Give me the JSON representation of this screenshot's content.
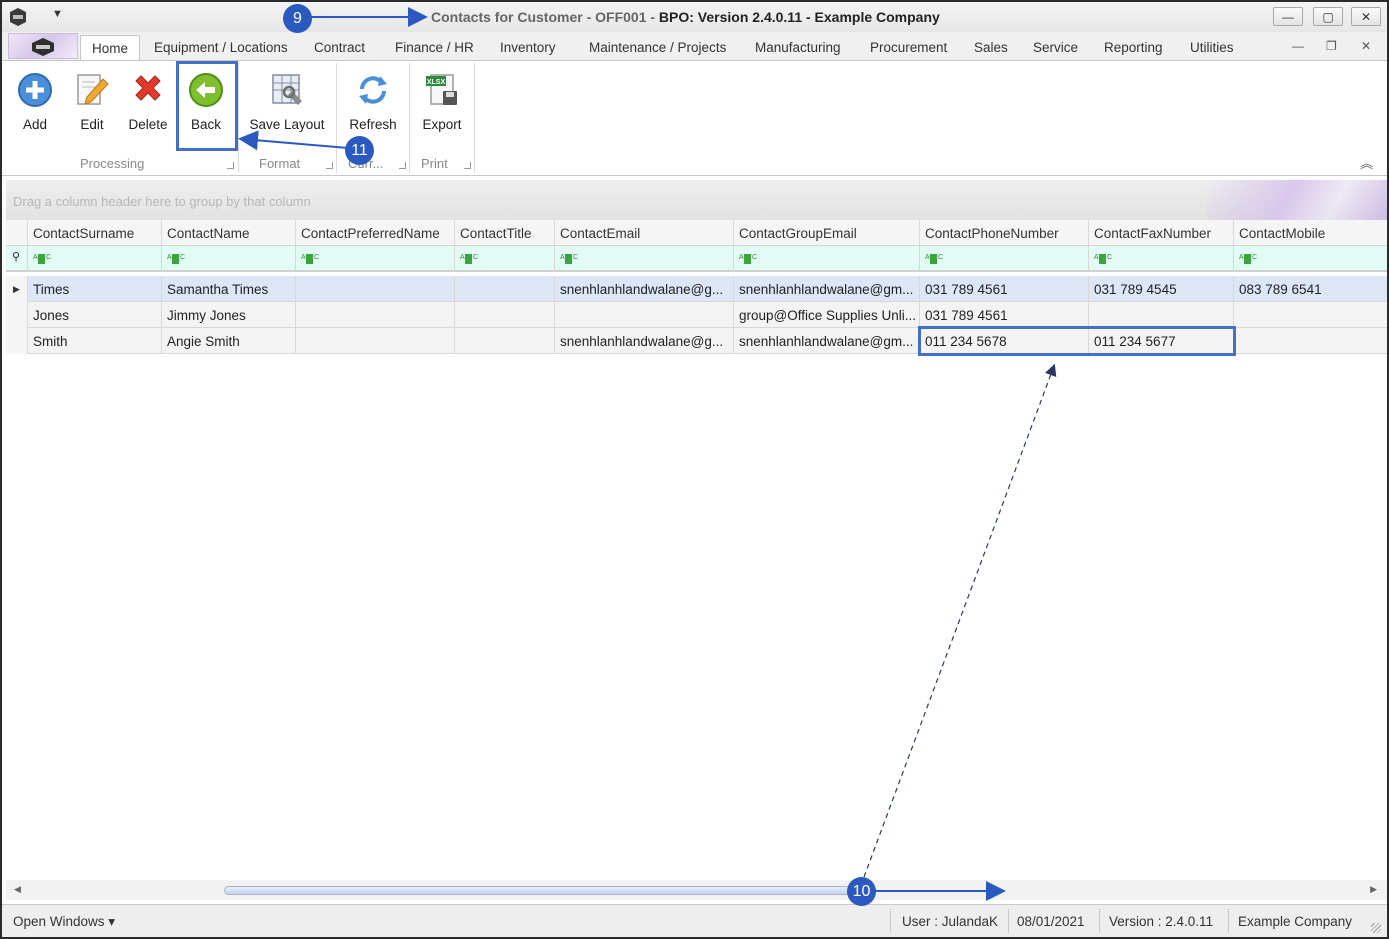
{
  "titlebar": {
    "title_part1": "Contacts for Customer - OFF001 - ",
    "title_part2": "BPO: Version 2.4.0.11 - Example Company",
    "minimize": "—",
    "maximize": "▢",
    "close": "✕"
  },
  "tabs": [
    "Home",
    "Equipment / Locations",
    "Contract",
    "Finance / HR",
    "Inventory",
    "Maintenance / Projects",
    "Manufacturing",
    "Procurement",
    "Sales",
    "Service",
    "Reporting",
    "Utilities"
  ],
  "mdi_controls": {
    "minimize": "—",
    "restore": "❐",
    "close": "✕"
  },
  "ribbon": {
    "buttons": {
      "add": "Add",
      "edit": "Edit",
      "delete": "Delete",
      "back": "Back",
      "save_layout": "Save Layout",
      "refresh": "Refresh",
      "export": "Export"
    },
    "groups": {
      "processing": "Processing",
      "format": "Format",
      "current": "Curr...",
      "print": "Print"
    },
    "export_badge": "XLSX"
  },
  "grid": {
    "group_panel_hint": "Drag a column header here to group by that column",
    "columns": [
      "ContactSurname",
      "ContactName",
      "ContactPreferredName",
      "ContactTitle",
      "ContactEmail",
      "ContactGroupEmail",
      "ContactPhoneNumber",
      "ContactFaxNumber",
      "ContactMobile"
    ],
    "rows": [
      [
        "Times",
        "Samantha Times",
        "",
        "",
        "snenhlanhlandwalane@g...",
        "snenhlanhlandwalane@gm...",
        "031 789 4561",
        "031 789 4545",
        "083 789 6541"
      ],
      [
        "Jones",
        "Jimmy Jones",
        "",
        "",
        "",
        "group@Office Supplies Unli...",
        "031 789 4561",
        "",
        ""
      ],
      [
        "Smith",
        "Angie Smith",
        "",
        "",
        "snenhlanhlandwalane@g...",
        "snenhlanhlandwalane@gm...",
        "011 234 5678",
        "011 234 5677",
        ""
      ]
    ]
  },
  "statusbar": {
    "open_windows": "Open Windows ▾",
    "user": "User : JulandaK",
    "date": "08/01/2021",
    "version": "Version : 2.4.0.11",
    "company": "Example Company"
  },
  "annotations": {
    "badge_9": "9",
    "badge_10": "10",
    "badge_11": "11"
  },
  "colors": {
    "annotation_blue": "#2a5ac0",
    "filter_row": "#e3fbf5",
    "selected_row": "#dde6f7"
  }
}
